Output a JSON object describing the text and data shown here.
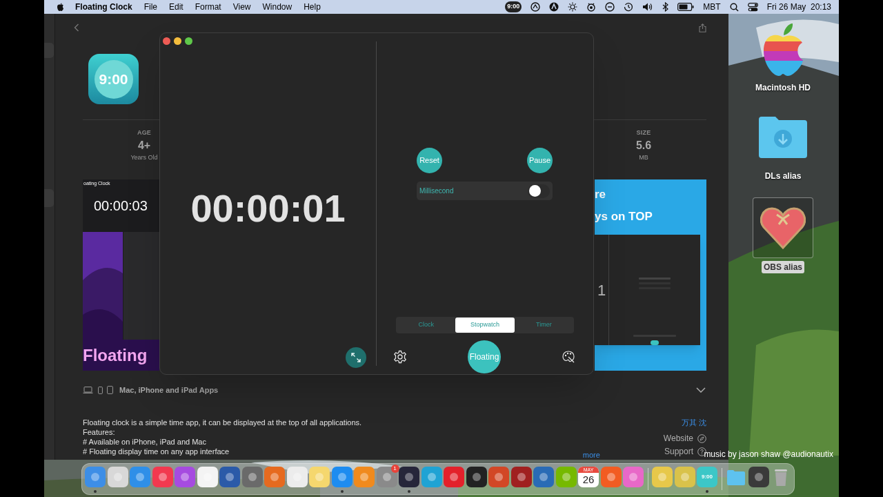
{
  "menu_bar": {
    "app_name": "Floating Clock",
    "menus": [
      "File",
      "Edit",
      "Format",
      "View",
      "Window",
      "Help"
    ],
    "clock_badge": "9:00",
    "input_source": "MBT",
    "datetime": "Fri 26 May  20:13"
  },
  "app_store": {
    "app_icon_label": "9:00",
    "info": [
      {
        "heading": "AGE",
        "value": "4+",
        "caption": "Years Old"
      },
      {
        "heading": "SIZE",
        "value": "5.6",
        "caption": "MB"
      }
    ],
    "screenshots": [
      {
        "kind": "dark",
        "title": "oating Clock",
        "time": "00:00:03",
        "banner": "Floating"
      },
      {
        "kind": "blue",
        "lines": [
          "re",
          "ys on TOP"
        ],
        "digit": "1"
      }
    ],
    "platforms": "Mac, iPhone and iPad Apps",
    "description": [
      "Floating clock is a simple time app, it can be displayed at the top of all applications.",
      "Features:",
      "# Available on iPhone, iPad and Mac",
      "# Floating display time on any app interface"
    ],
    "more": "more",
    "developer": "万其 沈",
    "links": [
      {
        "label": "Website",
        "kind": "website"
      },
      {
        "label": "Support",
        "kind": "support"
      }
    ]
  },
  "clock_window": {
    "time": "00:00:01",
    "buttons": [
      "Reset",
      "Pause"
    ],
    "millisecond": {
      "label": "Millisecond",
      "on": false
    },
    "tabs": [
      {
        "label": "Clock",
        "selected": false
      },
      {
        "label": "Stopwatch",
        "selected": true
      },
      {
        "label": "Timer",
        "selected": false
      }
    ],
    "floating_button": "Floating"
  },
  "desktop_icons": [
    {
      "label": "Macintosh HD",
      "kind": "disk",
      "selected": false
    },
    {
      "label": "DLs alias",
      "kind": "folder",
      "selected": false
    },
    {
      "label": "OBS alias",
      "kind": "heart",
      "selected": true
    }
  ],
  "dock": [
    {
      "kind": "app",
      "color": "#3d8ee6",
      "running": true
    },
    {
      "kind": "app",
      "color": "#d8d8d8",
      "running": false
    },
    {
      "kind": "app",
      "color": "#2f8fe8",
      "running": false
    },
    {
      "kind": "app",
      "color": "#f2394f",
      "running": false
    },
    {
      "kind": "app",
      "color": "#a64be0",
      "running": false
    },
    {
      "kind": "app",
      "color": "#f4f4f4",
      "running": false
    },
    {
      "kind": "app",
      "color": "#2b5aa8",
      "running": false
    },
    {
      "kind": "app",
      "color": "#6a6a6a",
      "running": false
    },
    {
      "kind": "app",
      "color": "#e66a1f",
      "running": false
    },
    {
      "kind": "app",
      "color": "#ececec",
      "running": false
    },
    {
      "kind": "app",
      "color": "#f5d76e",
      "running": false
    },
    {
      "kind": "app",
      "color": "#1d8cf0",
      "running": true
    },
    {
      "kind": "app",
      "color": "#f08a1d",
      "running": false
    },
    {
      "kind": "app",
      "color": "#8a8a8a",
      "running": false,
      "badge": "1"
    },
    {
      "kind": "app",
      "color": "#26263a",
      "running": true
    },
    {
      "kind": "app",
      "color": "#1fa3d4",
      "running": false
    },
    {
      "kind": "app",
      "color": "#e3212b",
      "running": false
    },
    {
      "kind": "app",
      "color": "#222222",
      "running": false
    },
    {
      "kind": "app",
      "color": "#d24726",
      "running": false
    },
    {
      "kind": "app",
      "color": "#a02020",
      "running": false
    },
    {
      "kind": "app",
      "color": "#2a6bb5",
      "running": false
    },
    {
      "kind": "app",
      "color": "#76b900",
      "running": false
    },
    {
      "kind": "calendar",
      "month": "MAY",
      "day": "26",
      "running": false
    },
    {
      "kind": "app",
      "color": "#f25c22",
      "running": false
    },
    {
      "kind": "app",
      "color": "#e868c8",
      "running": false
    },
    {
      "kind": "separator"
    },
    {
      "kind": "app",
      "color": "#e7c84a",
      "running": false
    },
    {
      "kind": "app",
      "color": "#d9c24a",
      "running": false
    },
    {
      "kind": "clock",
      "label": "9:00",
      "running": true
    },
    {
      "kind": "separator"
    },
    {
      "kind": "folder",
      "running": false
    },
    {
      "kind": "app",
      "color": "#3a3a3a",
      "running": false
    },
    {
      "kind": "trash",
      "running": false
    }
  ],
  "video_caption": "music by jason shaw @audionautix"
}
